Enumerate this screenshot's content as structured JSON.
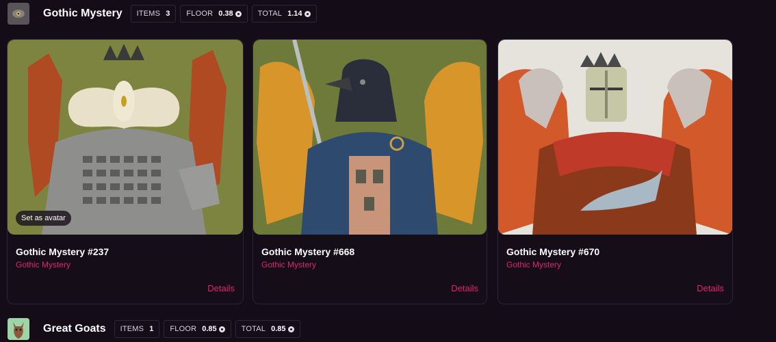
{
  "collections": [
    {
      "name": "Gothic Mystery",
      "stats": {
        "items_label": "ITEMS",
        "items_value": "3",
        "floor_label": "FLOOR",
        "floor_value": "0.38",
        "total_label": "TOTAL",
        "total_value": "1.14"
      },
      "cards": [
        {
          "title": "Gothic Mystery #237",
          "collection": "Gothic Mystery",
          "action": "Details",
          "overlay": "Set as avatar"
        },
        {
          "title": "Gothic Mystery #668",
          "collection": "Gothic Mystery",
          "action": "Details"
        },
        {
          "title": "Gothic Mystery #670",
          "collection": "Gothic Mystery",
          "action": "Details"
        }
      ]
    },
    {
      "name": "Great Goats",
      "stats": {
        "items_label": "ITEMS",
        "items_value": "1",
        "floor_label": "FLOOR",
        "floor_value": "0.85",
        "total_label": "TOTAL",
        "total_value": "0.85"
      }
    }
  ],
  "colors": {
    "accent": "#e2236a",
    "background": "#140d17"
  },
  "icons": {
    "currency": "coin-icon"
  }
}
